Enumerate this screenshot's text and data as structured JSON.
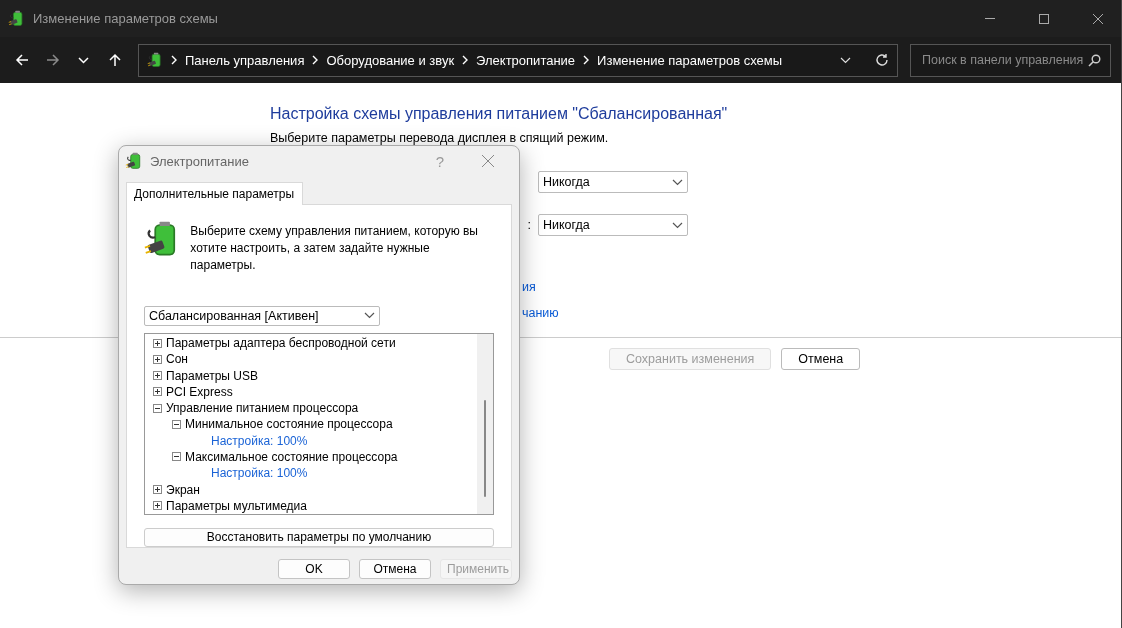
{
  "window": {
    "title": "Изменение параметров схемы"
  },
  "nav_buttons": [
    {
      "kind": "back",
      "disabled": false
    },
    {
      "kind": "forward",
      "disabled": true
    },
    {
      "kind": "recent",
      "disabled": false
    },
    {
      "kind": "up",
      "disabled": false
    }
  ],
  "address_bar": {
    "path": [
      "Панель управления",
      "Оборудование и звук",
      "Электропитание",
      "Изменение параметров схемы"
    ]
  },
  "search": {
    "placeholder": "Поиск в панели управления"
  },
  "plan": {
    "heading": "Настройка схемы управления питанием \"Сбалансированная\"",
    "subtitle": "Выберите параметры перевода дисплея в спящий режим.",
    "settings": [
      {
        "value": "Никогда"
      },
      {
        "label": ":",
        "value": "Никогда"
      }
    ],
    "links": [
      "ия",
      "чанию"
    ],
    "buttons": [
      {
        "label": "Сохранить изменения",
        "disabled": true
      },
      {
        "label": "Отмена",
        "disabled": false
      }
    ]
  },
  "dialog": {
    "title": "Электропитание",
    "help": "?",
    "tabs": [
      {
        "label": "Дополнительные параметры",
        "selected": true
      }
    ],
    "intro": "Выберите схему управления питанием, которую вы хотите настроить, а затем задайте нужные параметры.",
    "scheme": "Сбалансированная [Активен]",
    "tree": [
      {
        "kind": "group",
        "label": "Параметры адаптера беспроводной сети",
        "expanded": false
      },
      {
        "kind": "group",
        "label": "Сон",
        "expanded": false
      },
      {
        "kind": "group",
        "label": "Параметры USB",
        "expanded": false
      },
      {
        "kind": "group",
        "label": "PCI Express",
        "expanded": false
      },
      {
        "kind": "group",
        "label": "Управление питанием процессора",
        "expanded": true,
        "children": [
          {
            "kind": "group",
            "label": "Минимальное состояние процессора",
            "expanded": true,
            "children": [
              {
                "kind": "value",
                "label": "Настройка: 100%"
              }
            ]
          },
          {
            "kind": "group",
            "label": "Максимальное состояние процессора",
            "expanded": true,
            "children": [
              {
                "kind": "value",
                "label": "Настройка: 100%"
              }
            ]
          }
        ]
      },
      {
        "kind": "group",
        "label": "Экран",
        "expanded": false
      },
      {
        "kind": "group",
        "label": "Параметры мультимедиа",
        "expanded": false
      }
    ],
    "restore_button": "Восстановить параметры по умолчанию",
    "buttons": [
      {
        "label": "OK",
        "disabled": false
      },
      {
        "label": "Отмена",
        "disabled": false
      },
      {
        "label": "Применить",
        "disabled": true
      }
    ]
  }
}
